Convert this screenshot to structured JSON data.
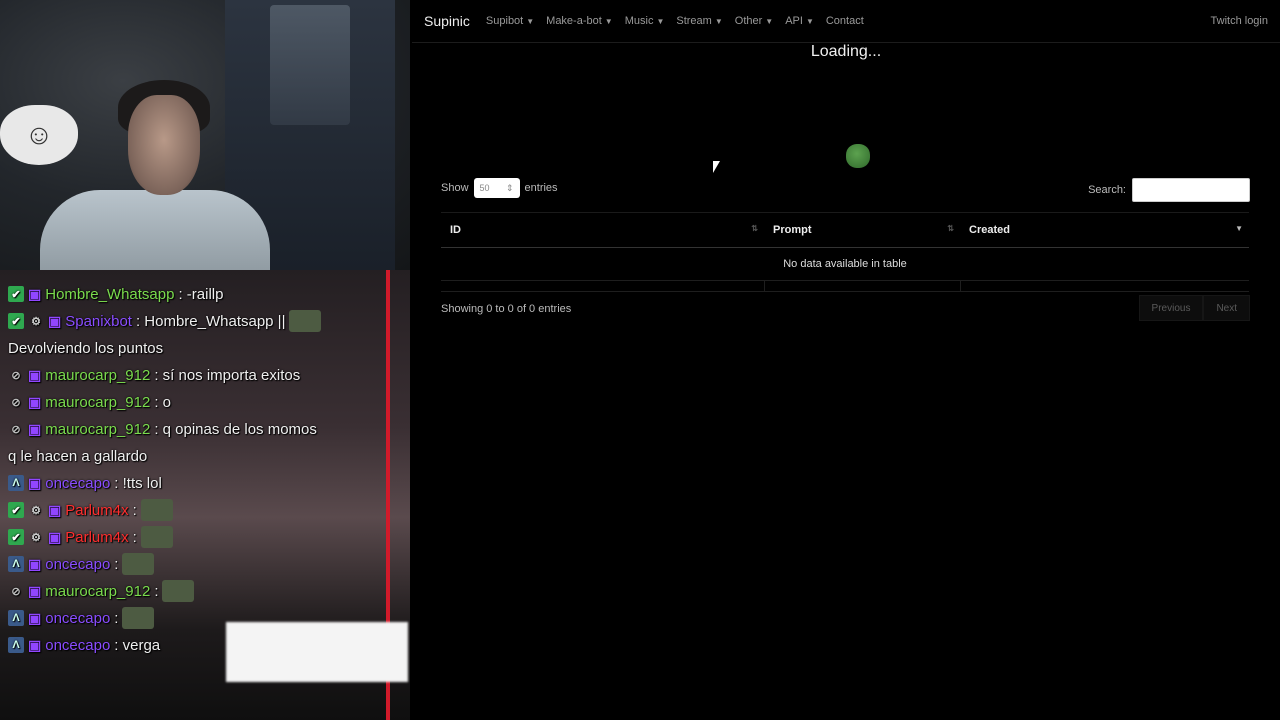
{
  "stream": {
    "chat": [
      {
        "badges": [
          "check",
          "twitch"
        ],
        "user": "Hombre_Whatsapp",
        "user_color": "green",
        "text": ": -raillp",
        "emotes": 0
      },
      {
        "badges": [
          "check",
          "bot",
          "twitch"
        ],
        "user": "Spanixbot",
        "user_color": "purple",
        "text": ": Hombre_Whatsapp ||",
        "emotes": 1
      },
      {
        "badges": [],
        "user": "",
        "user_color": "",
        "text": "Devolviendo los puntos",
        "emotes": 0
      },
      {
        "badges": [
          "eye",
          "twitch"
        ],
        "user": "maurocarp_912",
        "user_color": "green",
        "text": ": sí nos importa exitos",
        "emotes": 0
      },
      {
        "badges": [
          "eye",
          "twitch"
        ],
        "user": "maurocarp_912",
        "user_color": "green",
        "text": ": o",
        "emotes": 0
      },
      {
        "badges": [
          "eye",
          "twitch"
        ],
        "user": "maurocarp_912",
        "user_color": "green",
        "text": ":      q opinas de los momos",
        "emotes": 0
      },
      {
        "badges": [],
        "user": "",
        "user_color": "",
        "text": "q le hacen a gallardo",
        "emotes": 0
      },
      {
        "badges": [
          "a",
          "twitch"
        ],
        "user": "oncecapo",
        "user_color": "purple",
        "text": ": !tts lol",
        "emotes": 0
      },
      {
        "badges": [
          "check",
          "bot",
          "twitch"
        ],
        "user": "Parlum4x",
        "user_color": "red",
        "text": ":",
        "emotes": 1
      },
      {
        "badges": [
          "check",
          "bot",
          "twitch"
        ],
        "user": "Parlum4x",
        "user_color": "red",
        "text": ":",
        "emotes": 1
      },
      {
        "badges": [
          "a",
          "twitch"
        ],
        "user": "oncecapo",
        "user_color": "purple",
        "text": ":",
        "emotes": 1
      },
      {
        "badges": [
          "eye",
          "twitch"
        ],
        "user": "maurocarp_912",
        "user_color": "green",
        "text": ":",
        "emotes": 1
      },
      {
        "badges": [
          "a",
          "twitch"
        ],
        "user": "oncecapo",
        "user_color": "purple",
        "text": ":",
        "emotes": 1
      },
      {
        "badges": [
          "a",
          "twitch"
        ],
        "user": "oncecapo",
        "user_color": "purple",
        "text": ": verga",
        "emotes": 0
      }
    ]
  },
  "navbar": {
    "brand": "Supinic",
    "items": [
      {
        "label": "Supibot",
        "dropdown": true
      },
      {
        "label": "Make-a-bot",
        "dropdown": true
      },
      {
        "label": "Music",
        "dropdown": true
      },
      {
        "label": "Stream",
        "dropdown": true
      },
      {
        "label": "Other",
        "dropdown": true
      },
      {
        "label": "API",
        "dropdown": true
      },
      {
        "label": "Contact",
        "dropdown": false
      }
    ],
    "login": "Twitch login"
  },
  "page": {
    "loading": "Loading...",
    "show_label": "Show",
    "entries_label": "entries",
    "page_length": "50",
    "search_label": "Search:",
    "search_value": "",
    "columns": [
      "ID",
      "Prompt",
      "Created"
    ],
    "empty_message": "No data available in table",
    "info": "Showing 0 to 0 of 0 entries",
    "prev_label": "Previous",
    "next_label": "Next"
  }
}
